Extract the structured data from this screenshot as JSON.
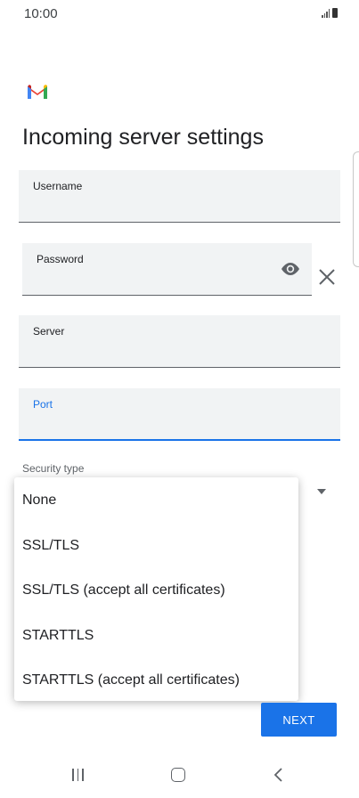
{
  "status_bar": {
    "time": "10:00"
  },
  "page": {
    "title": "Incoming server settings"
  },
  "fields": {
    "username": {
      "label": "Username",
      "value": ""
    },
    "password": {
      "label": "Password",
      "value": ""
    },
    "server": {
      "label": "Server",
      "value": ""
    },
    "port": {
      "label": "Port",
      "value": ""
    }
  },
  "security": {
    "label": "Security type",
    "options": [
      "None",
      "SSL/TLS",
      "SSL/TLS (accept all certificates)",
      "STARTTLS",
      "STARTTLS (accept all certificates)"
    ]
  },
  "actions": {
    "next_label": "NEXT"
  },
  "colors": {
    "accent": "#1a73e8",
    "field_bg": "#f1f3f4"
  },
  "icons": [
    "gmail-logo",
    "eye-icon",
    "close-icon",
    "dropdown-arrow-icon",
    "recent-apps-icon",
    "home-icon",
    "back-icon"
  ]
}
